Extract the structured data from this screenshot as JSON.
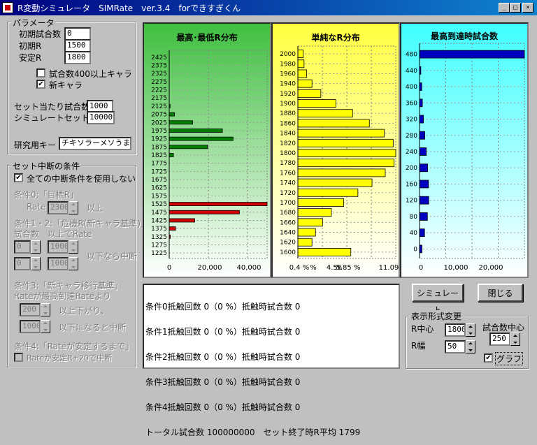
{
  "window": {
    "title": "R変動シミュレータ　SIMRate　ver.3.4　forできすぎくん"
  },
  "params": {
    "group_label": "パラメータ",
    "initial_games_label": "初期試合数",
    "initial_games_value": "0",
    "initial_r_label": "初期R",
    "initial_r_value": "1500",
    "stable_r_label": "安定R",
    "stable_r_value": "1800",
    "over400_label": "試合数400以上キャラ",
    "over400_checked": "",
    "new_char_label": "新キャラ",
    "new_char_checked": "✔",
    "games_per_set_label": "セット当たり試合数",
    "games_per_set_value": "1000",
    "sim_sets_label": "シミュレートセット数",
    "sim_sets_value": "10000",
    "research_key_label": "研究用キー",
    "research_key_value": "チキソラーメソうまい"
  },
  "stop_conditions": {
    "group_label": "セット中断の条件",
    "disable_all_label": "全ての中断条件を使用しない",
    "disable_all_checked": "✔",
    "cond0_label": "条件0:「目標R」",
    "rate_label": "Rate",
    "rate_value": "2300",
    "above_label": "以上",
    "cond12_label": "条件1・2:「危機R(新キャラ基準)」",
    "games_label": "試合数",
    "above_rate_label": "以上でRate",
    "row1_games": "0",
    "row1_rate": "1000",
    "row2_games": "0",
    "row2_rate": "1000",
    "below_stop_label": "以下なら中断",
    "cond3_label": "条件3:「新キャラ移行基準」",
    "cond3_desc": "Rateが最高到達Rateより",
    "drop_value": "200",
    "drop_label": "以上下がり、",
    "floor_value": "1000",
    "floor_label": "以下になると中断",
    "cond4_label": "条件4:「Rateが安定するまで」",
    "cond4_check_label": "Rateが安定R±20で中断"
  },
  "charts": {
    "left_title": "最高･最低R分布",
    "mid_title": "単純なR分布",
    "right_title": "最高到達時試合数",
    "left_ticks_x": [
      "0",
      "20,000",
      "40,000"
    ],
    "mid_ticks_x": [
      "0.4 %",
      "%",
      "4.56",
      "5.85 %",
      "11.09"
    ],
    "right_ticks_x": [
      "0",
      "10,000",
      "20,000"
    ]
  },
  "chart_data": [
    {
      "type": "bar",
      "title": "最高･最低R分布",
      "categories": [
        "2425",
        "2375",
        "2325",
        "2275",
        "2225",
        "2175",
        "2125",
        "2075",
        "2025",
        "1975",
        "1925",
        "1875",
        "1825",
        "1775",
        "1725",
        "1675",
        "1625",
        "1575",
        "1525",
        "1475",
        "1425",
        "1375",
        "1325",
        "1275",
        "1225"
      ],
      "series": [
        {
          "values": [
            0,
            0,
            0,
            0,
            0,
            0,
            400,
            2500,
            11000,
            25000,
            30000,
            18000,
            2000,
            0,
            0,
            0,
            0,
            0,
            0,
            0,
            0,
            0,
            0,
            0,
            0
          ]
        },
        {
          "values": [
            0,
            0,
            0,
            0,
            0,
            0,
            0,
            0,
            0,
            0,
            0,
            0,
            0,
            0,
            0,
            0,
            0,
            0,
            46000,
            33000,
            12000,
            3000,
            500,
            0,
            0
          ]
        }
      ],
      "xlim": [
        0,
        46000
      ]
    },
    {
      "type": "bar",
      "title": "単純なR分布",
      "categories": [
        "2000",
        "1980",
        "1960",
        "1940",
        "1920",
        "1900",
        "1880",
        "1860",
        "1840",
        "1820",
        "1800",
        "1780",
        "1760",
        "1740",
        "1720",
        "1700",
        "1680",
        "1660",
        "1640",
        "1620",
        "1600"
      ],
      "values": [
        0.6,
        0.7,
        1.0,
        1.6,
        2.6,
        4.3,
        6.2,
        8.1,
        9.8,
        10.8,
        11.09,
        10.9,
        9.9,
        8.4,
        6.8,
        5.2,
        3.8,
        2.8,
        2.0,
        1.6,
        6.0
      ],
      "xlim": [
        0,
        11.09
      ]
    },
    {
      "type": "bar",
      "title": "最高到達時試合数",
      "categories": [
        "480",
        "440",
        "400",
        "360",
        "320",
        "280",
        "240",
        "200",
        "160",
        "120",
        "80",
        "40",
        "0"
      ],
      "values": [
        48000,
        600,
        1000,
        1300,
        1800,
        2400,
        3100,
        3700,
        4100,
        4200,
        3600,
        2300,
        1100
      ],
      "xlim": [
        0,
        48000
      ]
    }
  ],
  "log": {
    "lines": [
      "条件0抵触回数 0（0 %）抵触時試合数 0",
      "条件1抵触回数 0（0 %）抵触時試合数 0",
      "条件2抵触回数 0（0 %）抵触時試合数 0",
      "条件3抵触回数 0（0 %）抵触時試合数 0",
      "条件4抵触回数 0（0 %）抵触時試合数 0",
      "トータル試合数 100000000　セット終了時R平均 1799"
    ]
  },
  "buttons": {
    "simulate": "シミュレート",
    "close": "閉じる"
  },
  "display": {
    "group_label": "表示形式変更",
    "r_center_label": "R中心",
    "r_center_value": "1800",
    "r_width_label": "R幅",
    "r_width_value": "50",
    "games_center_label": "試合数中心",
    "games_center_value": "250",
    "graph_label": "グラフ",
    "graph_checked": "✔"
  }
}
